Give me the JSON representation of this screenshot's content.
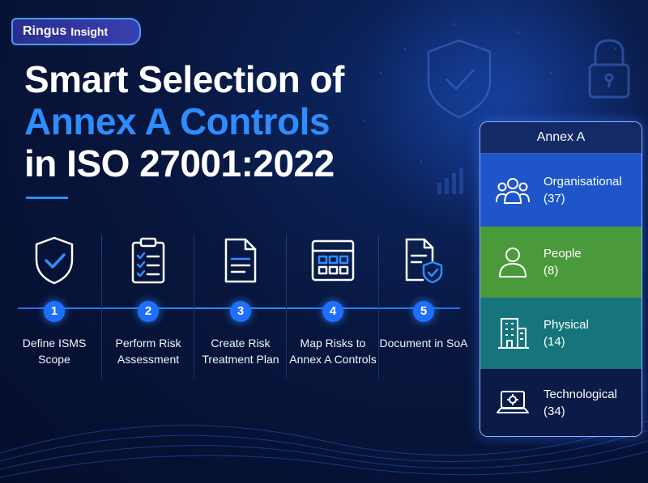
{
  "badge": {
    "brand": "Ringus",
    "tag": "Insight"
  },
  "title": {
    "line1": "Smart Selection of",
    "line2": "Annex A Controls",
    "line3": "in ISO 27001:2022"
  },
  "colors": {
    "accent": "#2f8cff",
    "organisational": "#1e55c9",
    "people": "#4a9a3c",
    "physical": "#16757c",
    "technological": "#0b1b47"
  },
  "steps": [
    {
      "number": "1",
      "label": "Define ISMS Scope",
      "icon": "shield-check-icon"
    },
    {
      "number": "2",
      "label": "Perform Risk Assessment",
      "icon": "clipboard-checklist-icon"
    },
    {
      "number": "3",
      "label": "Create Risk Treatment Plan",
      "icon": "document-icon"
    },
    {
      "number": "4",
      "label": "Map Risks to Annex A Controls",
      "icon": "calendar-grid-icon"
    },
    {
      "number": "5",
      "label": "Document in SoA",
      "icon": "document-shield-icon"
    }
  ],
  "annex": {
    "header": "Annex A",
    "categories": [
      {
        "name": "Organisational",
        "count": "(37)",
        "icon": "team-icon"
      },
      {
        "name": "People",
        "count": "(8)",
        "icon": "person-icon"
      },
      {
        "name": "Physical",
        "count": "(14)",
        "icon": "building-icon"
      },
      {
        "name": "Technological",
        "count": "(34)",
        "icon": "laptop-gear-icon"
      }
    ]
  }
}
